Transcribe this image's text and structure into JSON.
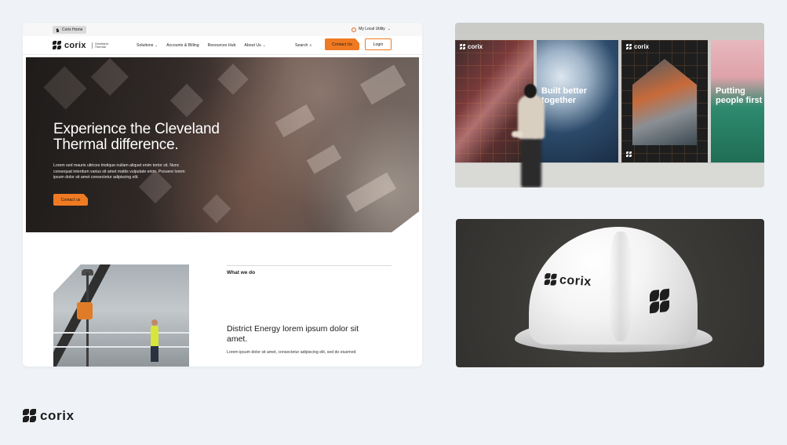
{
  "site": {
    "topbar": {
      "home_tab": "Corix Home",
      "utility_label": "My Local Utility"
    },
    "logo": {
      "word": "corix",
      "subbrand_line1": "Cleveland",
      "subbrand_line2": "Thermal"
    },
    "nav": {
      "items": [
        {
          "label": "Solutions",
          "has_dropdown": true
        },
        {
          "label": "Accounts & Billing",
          "has_dropdown": false
        },
        {
          "label": "Resources Hub",
          "has_dropdown": false
        },
        {
          "label": "About Us",
          "has_dropdown": true
        }
      ],
      "search_label": "Search",
      "contact_label": "Contact Us",
      "login_label": "Login"
    },
    "hero": {
      "heading": "Experience the Cleveland Thermal difference.",
      "body": "Lorem sed mauris ultrices tristique nullam aliquet enim tortor sit. Nunc consequat interdum varius sit amet mattis vulputate enim. Posuere lorem ipsum dolor sit amet consectetur adipiscing elit.",
      "button_label": "Contact us"
    },
    "section": {
      "label": "What we do",
      "heading": "District Energy lorem ipsum dolor sit amet.",
      "body": "Lorem ipsum dolor sit amet, consectetur adipiscing elit, sed do eiusmod"
    }
  },
  "posters": {
    "brand": "corix",
    "poster2_heading": "Built better together",
    "poster4_heading": "Putting people first"
  },
  "hardhat": {
    "brand": "corix"
  },
  "footer_brand": {
    "word": "corix"
  },
  "colors": {
    "accent": "#f07a22",
    "background": "#eff3f7",
    "dark": "#1d1d1d"
  }
}
